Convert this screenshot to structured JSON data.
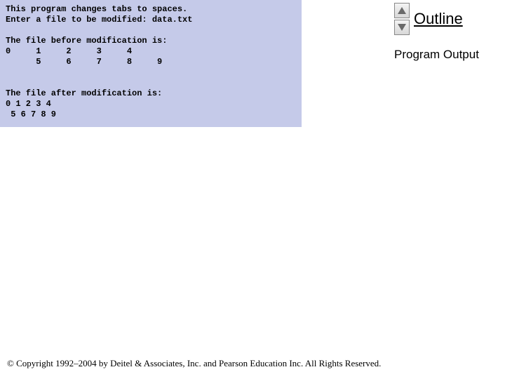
{
  "terminal": {
    "line1": "This program changes tabs to spaces.",
    "line2": "Enter a file to be modified: data.txt",
    "blank1": " ",
    "line3": "The file before modification is:",
    "line4": "0     1     2     3     4",
    "line5": "      5     6     7     8     9",
    "blank2": " ",
    "blank3": " ",
    "line6": "The file after modification is:",
    "line7": "0 1 2 3 4",
    "line8": " 5 6 7 8 9"
  },
  "right": {
    "outline": "Outline",
    "section": "Program Output"
  },
  "footer": "© Copyright 1992–2004 by Deitel & Associates, Inc. and Pearson Education Inc. All Rights Reserved."
}
